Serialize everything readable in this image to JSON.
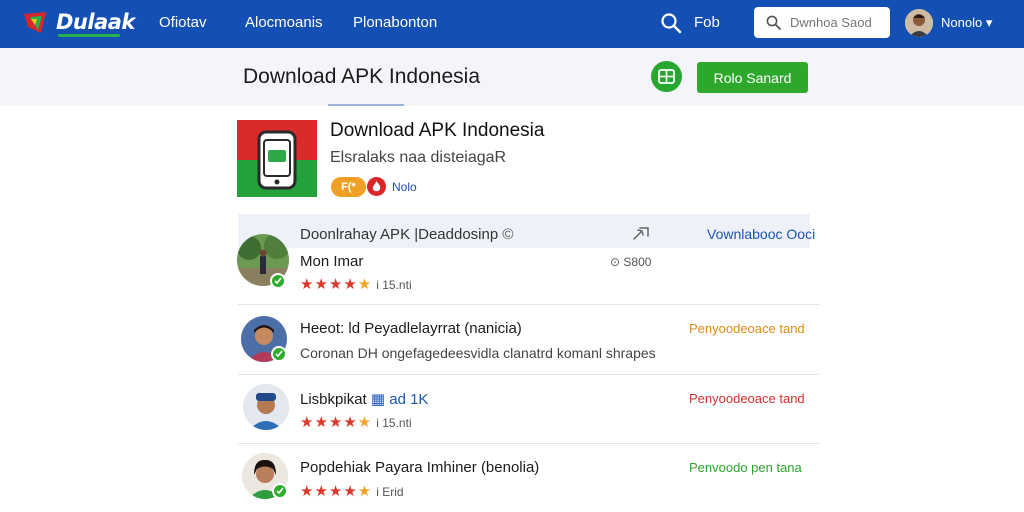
{
  "nav": {
    "logo_text": "Dulaak",
    "links": [
      "Ofiotav",
      "Alocmoanis",
      "Plonabonton"
    ],
    "search_label": "Fob",
    "search_placeholder": "Dwnhoa Saod",
    "user_name": "Nonolo",
    "user_caret": "▾"
  },
  "header": {
    "title": "Download  APK   Indonesia",
    "action_button": "Rolo Sanard"
  },
  "app": {
    "name": "Download APK Indonesia",
    "subtitle": "Elsralaks naa disteiagaR",
    "badge_label": "F(*",
    "badge_text": "Nolo"
  },
  "list": {
    "header_title": "Doonlrahay APK |Deaddosinp",
    "header_link": "Vownlabooc Ooci",
    "items": [
      {
        "title": "Mon Imar",
        "meta": "⊙ S800",
        "stars": 4,
        "rating": "i 15.nti"
      },
      {
        "title": "Heeot: ld Peyadlelayrrat (nanicia)",
        "subtitle": "Coronan DH ongefagedeesvidla clanatrd komanl shrapes",
        "action": "Penyoodeoace tand"
      },
      {
        "title": "Lisbkpikat",
        "tag": "ad 1K",
        "stars": 4,
        "rating": "i 15.nti",
        "action": "Penyoodeoace tand"
      },
      {
        "title": "Popdehiak Payara Imhiner (benolia)",
        "stars": 4,
        "rating": "i Erid",
        "action": "Penvoodo pen tana"
      }
    ]
  },
  "colors": {
    "brand": "#1450b4",
    "accent_green": "#2ea82b",
    "action_orange": "#e08a12",
    "action_red": "#d63030",
    "action_green": "#2ba52b"
  }
}
